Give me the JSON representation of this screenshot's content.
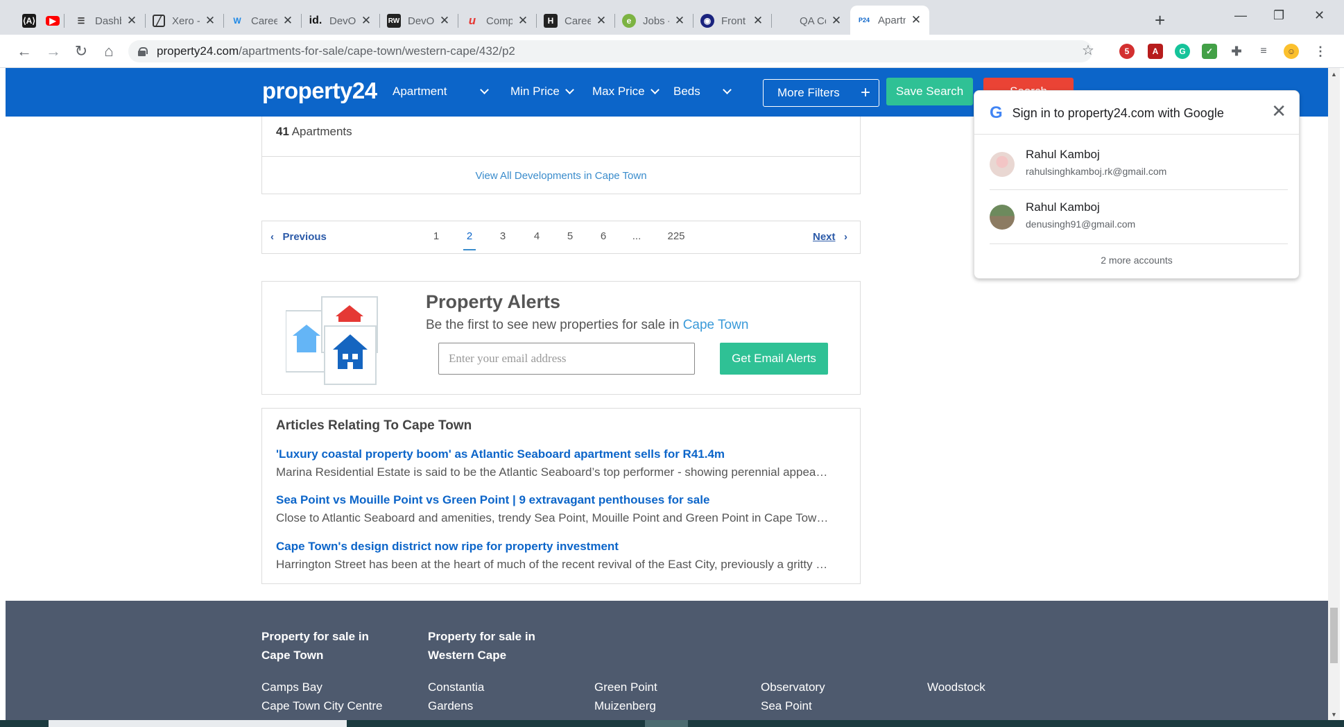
{
  "browser": {
    "tabs": [
      {
        "title": "",
        "icon": "angular-icon",
        "color": "#1a1a1a"
      },
      {
        "title": "",
        "icon": "youtube-icon",
        "color": "#ff0000"
      },
      {
        "title": "Dashboa",
        "icon": "dashboard-icon",
        "color": "#333333"
      },
      {
        "title": "Xero - IT",
        "icon": "xero-icon",
        "color": "#333333"
      },
      {
        "title": "Careers a",
        "icon": "workable-icon",
        "color": "#1e88e5"
      },
      {
        "title": "DevOps",
        "icon": "id-icon",
        "color": "#111111"
      },
      {
        "title": "DevOps",
        "icon": "rw-icon",
        "color": "#222222"
      },
      {
        "title": "Complet",
        "icon": "u-icon",
        "color": "#e53935"
      },
      {
        "title": "Careers |",
        "icon": "h-icon",
        "color": "#222222"
      },
      {
        "title": "Jobs - N",
        "icon": "e-icon",
        "color": "#7cb342"
      },
      {
        "title": "Front En",
        "icon": "globe-icon",
        "color": "#1a237e"
      },
      {
        "title": "QA Cons",
        "icon": "",
        "color": "#ffffff"
      },
      {
        "title": "Apartme",
        "icon": "p24-icon",
        "color": "#0c65c9"
      }
    ],
    "url_host": "property24.com",
    "url_path": "/apartments-for-sale/cape-town/western-cape/432/p2"
  },
  "header": {
    "logo": "property24",
    "type_label": "Apartment",
    "min_price": "Min Price",
    "max_price": "Max Price",
    "beds": "Beds",
    "more_filters": "More Filters",
    "save_search": "Save Search",
    "search": "Search"
  },
  "developments": {
    "count": "41",
    "count_label": "Apartments",
    "view_all": "View All Developments in Cape Town"
  },
  "pagination": {
    "previous": "Previous",
    "pages": [
      "1",
      "2",
      "3",
      "4",
      "5",
      "6",
      "...",
      "225"
    ],
    "current": "2",
    "next": "Next"
  },
  "alerts": {
    "title": "Property Alerts",
    "subtitle": "Be the first to see new properties for sale in",
    "location": "Cape Town",
    "email_placeholder": "Enter your email address",
    "button": "Get Email Alerts"
  },
  "articles": {
    "heading": "Articles Relating To Cape Town",
    "items": [
      {
        "title": "'Luxury coastal property boom' as Atlantic Seaboard apartment sells for R41.4m",
        "desc": "Marina Residential Estate is said to be the Atlantic Seaboard’s top performer - showing perennial appea…"
      },
      {
        "title": "Sea Point vs Mouille Point vs Green Point | 9 extravagant penthouses for sale",
        "desc": "Close to Atlantic Seaboard and amenities, trendy Sea Point, Mouille Point and Green Point in Cape Tow…"
      },
      {
        "title": "Cape Town's design district now ripe for property investment",
        "desc": "Harrington Street has been at the heart of much of the recent revival of the East City, previously a gritty …"
      }
    ]
  },
  "footer": {
    "col1_head": [
      "Property for sale in",
      "Cape Town"
    ],
    "col2_head": [
      "Property for sale in",
      "Western Cape"
    ],
    "links": [
      [
        "Camps Bay",
        "Cape Town City Centre"
      ],
      [
        "Constantia",
        "Gardens"
      ],
      [
        "Green Point",
        "Muizenberg"
      ],
      [
        "Observatory",
        "Sea Point"
      ],
      [
        "Woodstock"
      ]
    ]
  },
  "google_popup": {
    "title": "Sign in to property24.com with Google",
    "accounts": [
      {
        "name": "Rahul Kamboj",
        "email": "rahulsinghkamboj.rk@gmail.com"
      },
      {
        "name": "Rahul Kamboj",
        "email": "denusingh91@gmail.com"
      }
    ],
    "more": "2 more accounts"
  },
  "colors": {
    "brand_blue": "#0c65c9",
    "green": "#2fc195",
    "red": "#ea4335",
    "footer": "#4e5a6e"
  }
}
